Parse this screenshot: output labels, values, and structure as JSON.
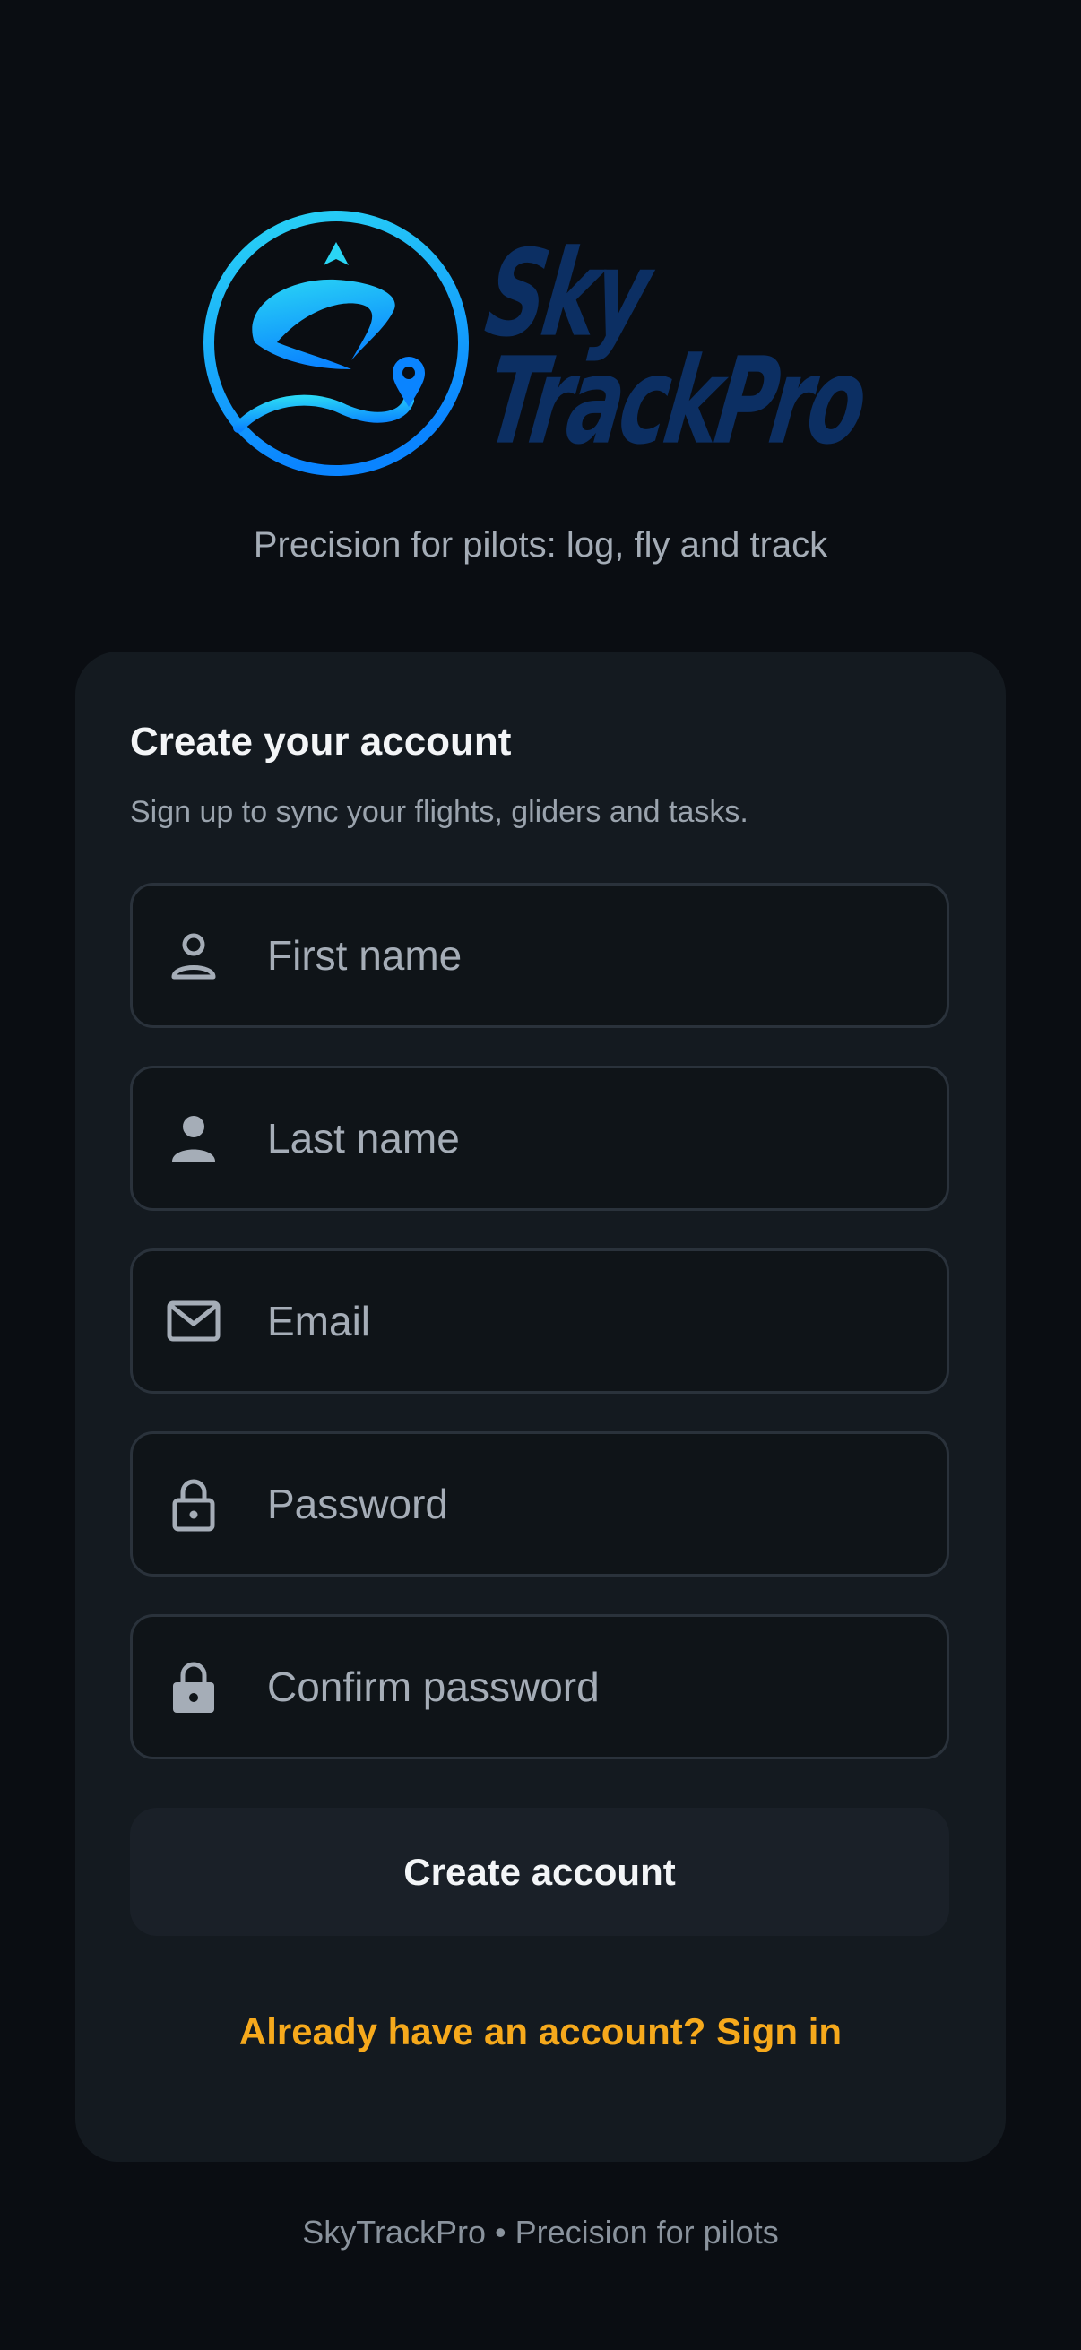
{
  "brand": {
    "logo_line1": "Sky",
    "logo_line2": "TrackPro",
    "tagline": "Precision for pilots: log, fly and track"
  },
  "signup": {
    "title": "Create your account",
    "subtitle": "Sign up to sync your flights, gliders and tasks.",
    "fields": [
      {
        "icon": "person-outline-icon",
        "placeholder": "First name",
        "value": ""
      },
      {
        "icon": "person-filled-icon",
        "placeholder": "Last name",
        "value": ""
      },
      {
        "icon": "envelope-icon",
        "placeholder": "Email",
        "value": ""
      },
      {
        "icon": "lock-outline-icon",
        "placeholder": "Password",
        "value": ""
      },
      {
        "icon": "lock-filled-icon",
        "placeholder": "Confirm password",
        "value": ""
      }
    ],
    "submit_label": "Create account",
    "signin_link": "Already have an account? Sign in"
  },
  "footer": {
    "text": "SkyTrackPro • Precision for pilots"
  },
  "colors": {
    "background": "#0a0d12",
    "card": "#141a20",
    "field_bg": "#0f1418",
    "field_border": "#2a323b",
    "button_bg": "#1a2028",
    "link": "#f6a91c",
    "logo_text": "#0c2f63",
    "logo_gradient_start": "#2ad6f5",
    "logo_gradient_end": "#0a84ff"
  }
}
